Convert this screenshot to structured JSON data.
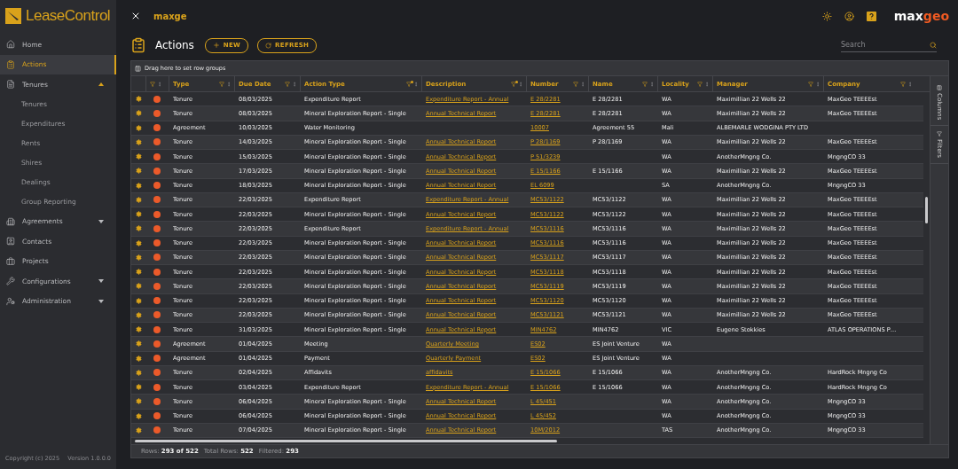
{
  "app": {
    "logo": "LeaseControl",
    "title": "maxge",
    "brand": {
      "part_1": "max",
      "part_2": "geo"
    }
  },
  "sidebar": {
    "items": [
      {
        "label": "Home",
        "kind": "home",
        "selected": false
      },
      {
        "label": "Actions",
        "kind": "actions",
        "selected": true
      },
      {
        "label": "Tenures",
        "kind": "tenures",
        "selected": false,
        "expanded": true,
        "children": [
          {
            "label": "Tenures",
            "selected": false
          },
          {
            "label": "Expenditures",
            "selected": false
          },
          {
            "label": "Rents",
            "selected": false
          },
          {
            "label": "Shires",
            "selected": false
          },
          {
            "label": "Dealings",
            "selected": false
          },
          {
            "label": "Group Reporting",
            "selected": false
          }
        ]
      },
      {
        "label": "Agreements",
        "kind": "agreements",
        "selected": false,
        "expanded": false
      },
      {
        "label": "Contacts",
        "kind": "contacts",
        "selected": false
      },
      {
        "label": "Projects",
        "kind": "projects",
        "selected": false
      },
      {
        "label": "Configurations",
        "kind": "configurations",
        "selected": false,
        "expanded": false
      },
      {
        "label": "Administration",
        "kind": "administration",
        "selected": false,
        "expanded": false
      }
    ],
    "copyright": "Copyright (c) 2025",
    "version": "Version 1.0.0.0"
  },
  "page": {
    "title": "Actions",
    "buttons": [
      {
        "label": "NEW",
        "kind": "new"
      },
      {
        "label": "REFRESH",
        "kind": "refresh"
      }
    ],
    "search": {
      "placeholder": "Search"
    }
  },
  "grid": {
    "group_panel": "Drag here to set row groups",
    "columns": [
      {
        "label": "Type",
        "kind": "text",
        "filtered": false
      },
      {
        "label": "Due Date",
        "kind": "text",
        "filtered": false
      },
      {
        "label": "Action Type",
        "kind": "text",
        "filtered": true
      },
      {
        "label": "Description",
        "kind": "link",
        "filtered": true
      },
      {
        "label": "Number",
        "kind": "link",
        "filtered": false
      },
      {
        "label": "Name",
        "kind": "text",
        "filtered": false
      },
      {
        "label": "Locality",
        "kind": "text",
        "filtered": false
      },
      {
        "label": "Manager",
        "kind": "text",
        "filtered": false
      },
      {
        "label": "Company",
        "kind": "text",
        "filtered": false
      }
    ],
    "rows": [
      {
        "cells": [
          "Tenure",
          "08/03/2025",
          "Expenditure Report",
          "Expenditure Report - Annual",
          "E 28/2281",
          "E 28/2281",
          "WA",
          "Maximillian 22 Wells 22",
          "MaxGeo TEEEEst"
        ]
      },
      {
        "cells": [
          "Tenure",
          "08/03/2025",
          "Mineral Exploration Report - Single",
          "Annual Technical Report",
          "E 28/2281",
          "E 28/2281",
          "WA",
          "Maximillian 22 Wells 22",
          "MaxGeo TEEEEst"
        ]
      },
      {
        "cells": [
          "Agreement",
          "10/03/2025",
          "Water Monitoring",
          "",
          "10007",
          "Agreement 55",
          "Mali",
          "ALBEMARLE WODGINA PTY LTD",
          ""
        ]
      },
      {
        "cells": [
          "Tenure",
          "14/03/2025",
          "Mineral Exploration Report - Single",
          "Annual Technical Report",
          "P 28/1169",
          "P 28/1169",
          "WA",
          "Maximillian 22 Wells 22",
          "MaxGeo TEEEEst"
        ]
      },
      {
        "cells": [
          "Tenure",
          "15/03/2025",
          "Mineral Exploration Report - Single",
          "Annual Technical Report",
          "P 51/3239",
          "",
          "WA",
          "AnotherMngng Co.",
          "MngngCO 33"
        ]
      },
      {
        "cells": [
          "Tenure",
          "17/03/2025",
          "Mineral Exploration Report - Single",
          "Annual Technical Report",
          "E 15/1166",
          "E 15/1166",
          "WA",
          "Maximillian 22 Wells 22",
          "MaxGeo TEEEEst"
        ]
      },
      {
        "cells": [
          "Tenure",
          "18/03/2025",
          "Mineral Exploration Report - Single",
          "Annual Technical Report",
          "EL 6099",
          "",
          "SA",
          "AnotherMngng Co.",
          "MngngCO 33"
        ]
      },
      {
        "cells": [
          "Tenure",
          "22/03/2025",
          "Expenditure Report",
          "Expenditure Report - Annual",
          "MC53/1122",
          "MC53/1122",
          "WA",
          "Maximillian 22 Wells 22",
          "MaxGeo TEEEEst"
        ]
      },
      {
        "cells": [
          "Tenure",
          "22/03/2025",
          "Mineral Exploration Report - Single",
          "Annual Technical Report",
          "MC53/1122",
          "MC53/1122",
          "WA",
          "Maximillian 22 Wells 22",
          "MaxGeo TEEEEst"
        ]
      },
      {
        "cells": [
          "Tenure",
          "22/03/2025",
          "Expenditure Report",
          "Expenditure Report - Annual",
          "MC53/1116",
          "MC53/1116",
          "WA",
          "Maximillian 22 Wells 22",
          "MaxGeo TEEEEst"
        ]
      },
      {
        "cells": [
          "Tenure",
          "22/03/2025",
          "Mineral Exploration Report - Single",
          "Annual Technical Report",
          "MC53/1116",
          "MC53/1116",
          "WA",
          "Maximillian 22 Wells 22",
          "MaxGeo TEEEEst"
        ]
      },
      {
        "cells": [
          "Tenure",
          "22/03/2025",
          "Mineral Exploration Report - Single",
          "Annual Technical Report",
          "MC53/1117",
          "MC53/1117",
          "WA",
          "Maximillian 22 Wells 22",
          "MaxGeo TEEEEst"
        ]
      },
      {
        "cells": [
          "Tenure",
          "22/03/2025",
          "Mineral Exploration Report - Single",
          "Annual Technical Report",
          "MC53/1118",
          "MC53/1118",
          "WA",
          "Maximillian 22 Wells 22",
          "MaxGeo TEEEEst"
        ]
      },
      {
        "cells": [
          "Tenure",
          "22/03/2025",
          "Mineral Exploration Report - Single",
          "Annual Technical Report",
          "MC53/1119",
          "MC53/1119",
          "WA",
          "Maximillian 22 Wells 22",
          "MaxGeo TEEEEst"
        ]
      },
      {
        "cells": [
          "Tenure",
          "22/03/2025",
          "Mineral Exploration Report - Single",
          "Annual Technical Report",
          "MC53/1120",
          "MC53/1120",
          "WA",
          "Maximillian 22 Wells 22",
          "MaxGeo TEEEEst"
        ]
      },
      {
        "cells": [
          "Tenure",
          "22/03/2025",
          "Mineral Exploration Report - Single",
          "Annual Technical Report",
          "MC53/1121",
          "MC53/1121",
          "WA",
          "Maximillian 22 Wells 22",
          "MaxGeo TEEEEst"
        ]
      },
      {
        "cells": [
          "Tenure",
          "31/03/2025",
          "Mineral Exploration Report - Single",
          "Annual Technical Report",
          "MIN4762",
          "MIN4762",
          "VIC",
          "Eugene Stokkies",
          "ATLAS OPERATIONS P…"
        ]
      },
      {
        "cells": [
          "Agreement",
          "01/04/2025",
          "Meeting",
          "Quarterly Meeting",
          "ES02",
          "ES Joint Venture",
          "WA",
          "",
          ""
        ]
      },
      {
        "cells": [
          "Agreement",
          "01/04/2025",
          "Payment",
          "Quarterly Payment",
          "ES02",
          "ES Joint Venture",
          "WA",
          "",
          ""
        ]
      },
      {
        "cells": [
          "Tenure",
          "02/04/2025",
          "Affidavits",
          "affidavits",
          "E 15/1066",
          "E 15/1066",
          "WA",
          "AnotherMngng Co.",
          "HardRock Mngng Co"
        ]
      },
      {
        "cells": [
          "Tenure",
          "03/04/2025",
          "Expenditure Report",
          "Expenditure Report - Annual",
          "E 15/1066",
          "E 15/1066",
          "WA",
          "AnotherMngng Co.",
          "HardRock Mngng Co"
        ]
      },
      {
        "cells": [
          "Tenure",
          "06/04/2025",
          "Mineral Exploration Report - Single",
          "Annual Technical Report",
          "L 45/451",
          "",
          "WA",
          "AnotherMngng Co.",
          "MngngCO 33"
        ]
      },
      {
        "cells": [
          "Tenure",
          "06/04/2025",
          "Mineral Exploration Report - Single",
          "Annual Technical Report",
          "L 45/452",
          "",
          "WA",
          "AnotherMngng Co.",
          "MngngCO 33"
        ]
      },
      {
        "cells": [
          "Tenure",
          "07/04/2025",
          "Mineral Exploration Report - Single",
          "Annual Technical Report",
          "10M/2012",
          "",
          "TAS",
          "AnotherMngng Co.",
          "MngngCO 33"
        ]
      }
    ],
    "side_tabs": [
      {
        "label": "Columns",
        "kind": "columns"
      },
      {
        "label": "Filters",
        "kind": "filters"
      }
    ],
    "status": [
      "Rows: **293 of 522**",
      "Total Rows: **522**",
      "Filtered: **293**"
    ]
  }
}
